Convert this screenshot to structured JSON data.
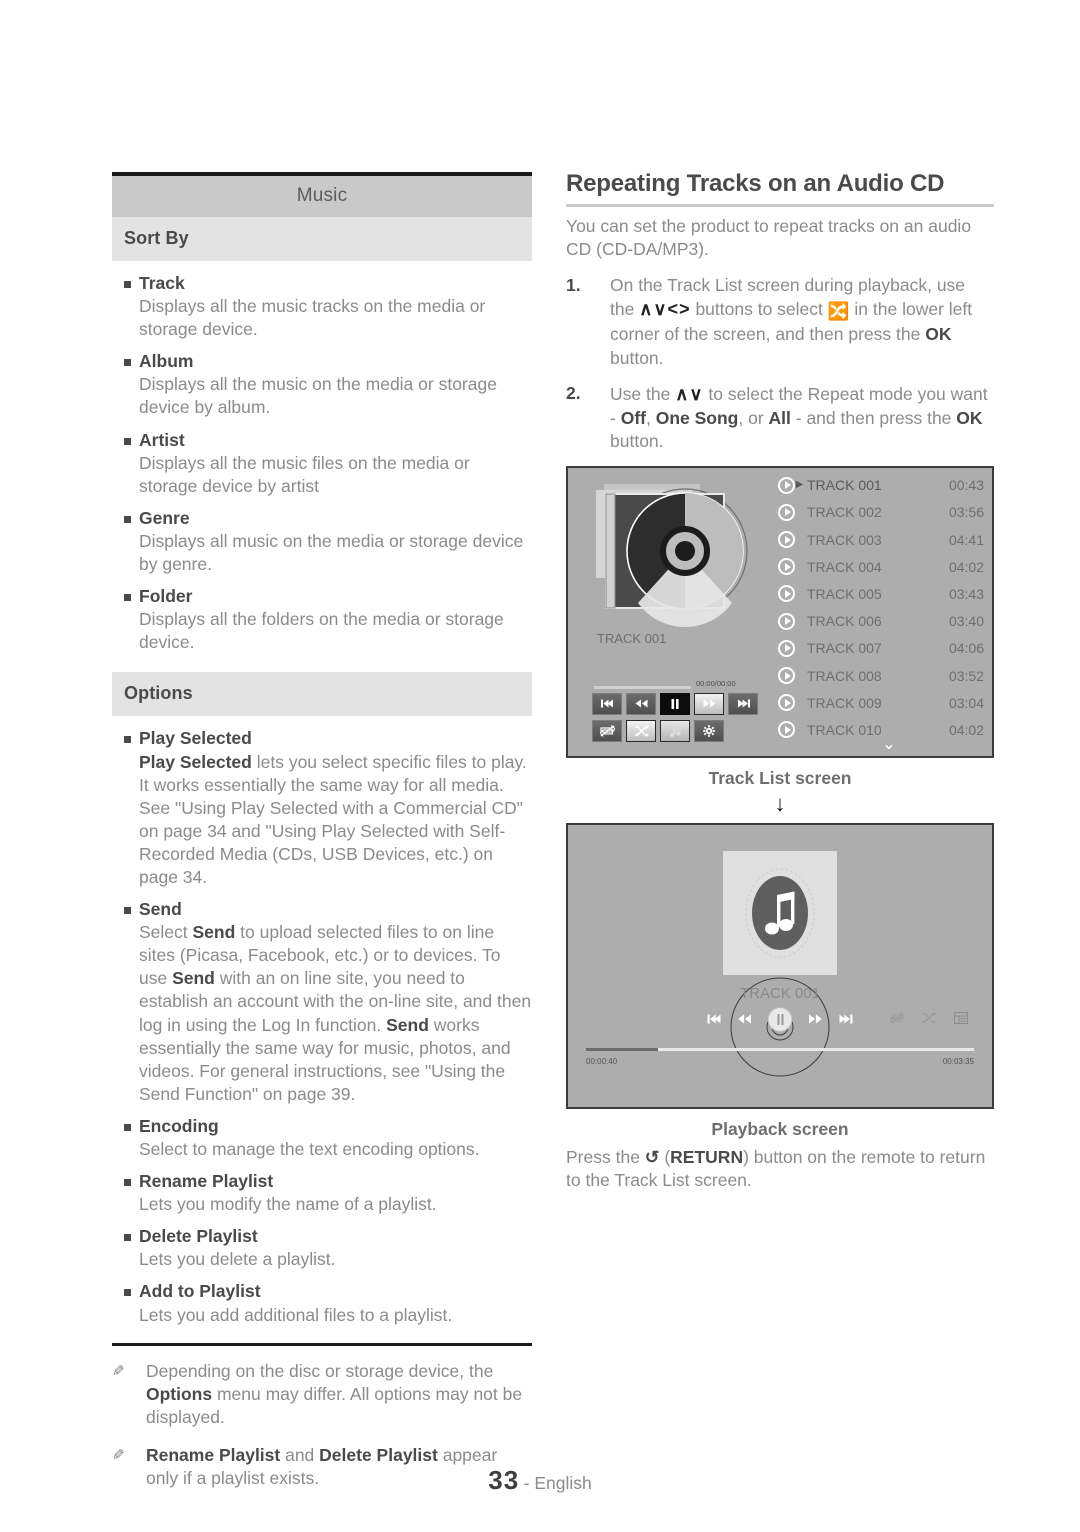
{
  "left_panel": {
    "header": "Music",
    "sections": [
      {
        "label": "Sort By",
        "items": [
          {
            "term": "Track",
            "desc": "Displays all the music tracks on the media or storage device."
          },
          {
            "term": "Album",
            "desc": "Displays all the music on the media or storage device by album."
          },
          {
            "term": "Artist",
            "desc": "Displays all the music files on the media or storage device by artist"
          },
          {
            "term": "Genre",
            "desc": "Displays all music on the media or storage device by genre."
          },
          {
            "term": "Folder",
            "desc": "Displays all the folders on the media or storage device."
          }
        ]
      },
      {
        "label": "Options",
        "items": [
          {
            "term": "Play Selected",
            "desc_html": "<b>Play Selected</b> lets you select specific files to play. It works essentially the same way for all media. See \"Using Play Selected with a Commercial CD\" on page 34 and \"Using Play Selected with Self-Recorded Media (CDs, USB Devices, etc.) on page 34."
          },
          {
            "term": "Send",
            "desc_html": "Select <b>Send</b> to upload selected files to on line sites (Picasa, Facebook, etc.) or to devices. To use <b>Send</b> with an on line site, you need to establish an account with the on-line site, and then log in using the Log In function. <b>Send</b> works essentially the same way for music, photos, and videos. For general instructions, see \"Using the Send Function\" on page 39."
          },
          {
            "term": "Encoding",
            "desc": "Select to manage the text encoding options."
          },
          {
            "term": "Rename Playlist",
            "desc": "Lets you modify the name of a playlist."
          },
          {
            "term": "Delete Playlist",
            "desc": "Lets you delete a playlist."
          },
          {
            "term": "Add to Playlist",
            "desc": "Lets you add additional files to a playlist."
          }
        ]
      }
    ],
    "notes": [
      {
        "icon": "pencil-note-icon",
        "html": "Depending on the disc or storage device, the <b>Options</b> menu may differ. All options may not be displayed."
      },
      {
        "icon": "pencil-note-icon",
        "html": "<b>Rename Playlist</b> and <b>Delete Playlist</b> appear only if a playlist exists."
      }
    ]
  },
  "right_panel": {
    "title": "Repeating Tracks on an Audio CD",
    "intro": "You can set the product to repeat tracks on an audio CD (CD-DA/MP3).",
    "steps": [
      {
        "num": "1.",
        "html": "On the Track List screen during playback, use the <span class=\"navkeys\">∧∨&lt;&gt;</span> buttons to select <span class=\"icon-rep-inline\">&#x1F500;</span> in the lower left corner of the screen, and then press the <b>OK</b> button."
      },
      {
        "num": "2.",
        "html": "Use the <span class=\"navkeys\">∧∨</span> to select the Repeat mode you want - <b>Off</b>, <b>One Song</b>, or <b>All</b> - and then press the <b>OK</b> button."
      }
    ],
    "track_list_screen": {
      "caption": "Track List screen",
      "now_playing_label": "TRACK 001",
      "mini_time": "00:00/00:00",
      "transport_buttons": [
        "skip-back-icon",
        "rewind-icon",
        "pause-icon",
        "fast-forward-icon",
        "skip-forward-icon"
      ],
      "option_buttons": [
        "repeat-icon",
        "shuffle-icon",
        "music-off-icon",
        "settings-gear-icon"
      ],
      "scroll_indicator": "chevron-down-icon",
      "tracks": [
        {
          "name": "TRACK 001",
          "time": "00:43",
          "playing": true
        },
        {
          "name": "TRACK 002",
          "time": "03:56",
          "playing": false
        },
        {
          "name": "TRACK 003",
          "time": "04:41",
          "playing": false
        },
        {
          "name": "TRACK 004",
          "time": "04:02",
          "playing": false
        },
        {
          "name": "TRACK 005",
          "time": "03:43",
          "playing": false
        },
        {
          "name": "TRACK 006",
          "time": "03:40",
          "playing": false
        },
        {
          "name": "TRACK 007",
          "time": "04:06",
          "playing": false
        },
        {
          "name": "TRACK 008",
          "time": "03:52",
          "playing": false
        },
        {
          "name": "TRACK 009",
          "time": "03:04",
          "playing": false
        },
        {
          "name": "TRACK 010",
          "time": "04:02",
          "playing": false
        }
      ]
    },
    "flow_arrow": "↓",
    "playback_screen": {
      "caption": "Playback screen",
      "track_title": "TRACK 001",
      "elapsed": "00:00:40",
      "total": "00:03:35",
      "progress_percent": 18.6,
      "transport_buttons": [
        "skip-back-icon",
        "rewind-icon",
        "pause-icon",
        "fast-forward-icon",
        "skip-forward-icon"
      ],
      "right_icons": [
        "repeat-icon",
        "shuffle-icon",
        "track-list-icon"
      ]
    },
    "tail_html": "Press the <b>↺</b> (<b>RETURN</b>) button on the remote to return to the Track List screen."
  },
  "footer": {
    "page_number": "33",
    "language": "- English"
  },
  "colors": {
    "header_bg": "#c9c9c9",
    "subheader_bg": "#e3e3e3",
    "rule": "#1a1a1a",
    "body_text": "#8b8b8b",
    "bold_text": "#4a4a4a",
    "screen_bg": "#adadad"
  }
}
